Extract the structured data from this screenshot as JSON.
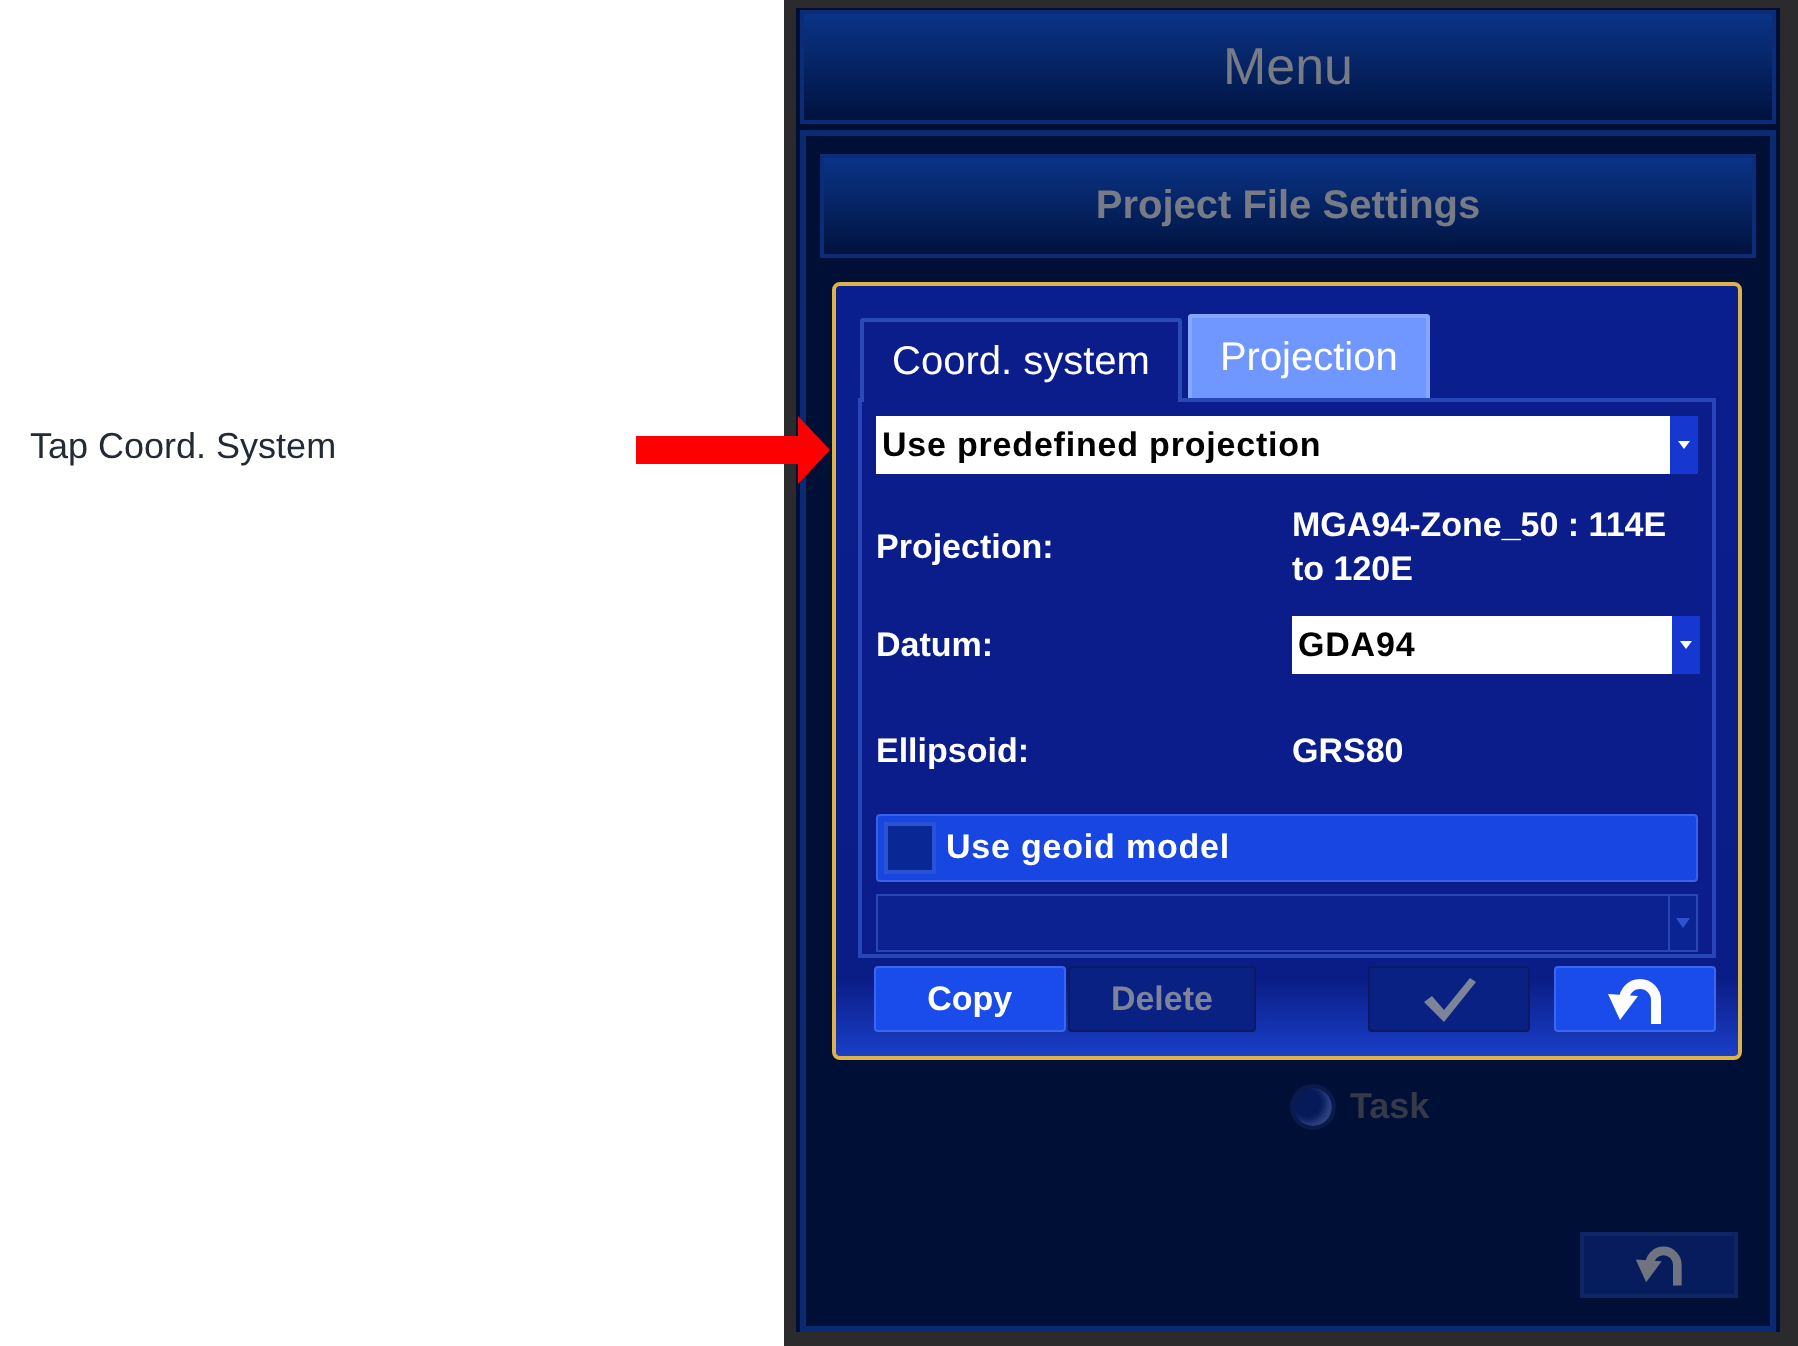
{
  "instruction": {
    "text": "Tap Coord. System"
  },
  "header": {
    "title": "Menu"
  },
  "panel": {
    "title": "Project File Settings",
    "radio_options": [
      {
        "label": "Task",
        "selected": false
      }
    ]
  },
  "dialog": {
    "tabs": [
      {
        "label": "Coord. system",
        "selected": false
      },
      {
        "label": "Projection",
        "selected": true
      }
    ],
    "mode_dropdown": {
      "value": "Use predefined projection"
    },
    "fields": [
      {
        "kind": "value",
        "label": "Projection:",
        "value": "MGA94-Zone_50 : 114E to 120E"
      },
      {
        "kind": "dropdown",
        "label": "Datum:",
        "value": "GDA94"
      },
      {
        "kind": "value",
        "label": "Ellipsoid:",
        "value": "GRS80"
      }
    ],
    "geoid": {
      "label": "Use geoid model",
      "checked": false
    },
    "geoid_dropdown": {
      "disabled": true
    },
    "buttons": [
      {
        "kind": "text",
        "label": "Copy",
        "disabled": false
      },
      {
        "kind": "text",
        "label": "Delete",
        "disabled": true
      },
      {
        "kind": "accept",
        "disabled": true
      },
      {
        "kind": "undo",
        "disabled": false
      }
    ]
  }
}
